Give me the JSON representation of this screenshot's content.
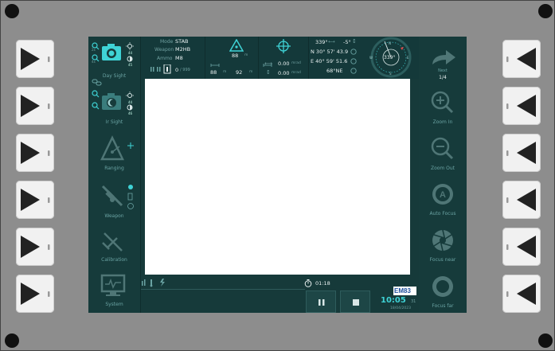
{
  "colors": {
    "bezel": "#8d8d8d",
    "screen_bg": "#163a3a",
    "accent_cyan": "#3fd3d6",
    "label_teal": "#6aa3a3",
    "icon_gray": "#4f7676",
    "alert_red": "#e04848"
  },
  "left_panel": {
    "day_sight": "Day Sight",
    "ir_sight": "Ir Sight",
    "ranging": "Ranging",
    "weapon": "Weapon",
    "calibration": "Calibration",
    "system": "System",
    "day_zoom_marks": [
      "2x",
      "4x"
    ],
    "day_brightness_marks": [
      "44",
      "45"
    ],
    "ir_brightness_marks": [
      "44",
      "46"
    ]
  },
  "header": {
    "mode_label": "Mode",
    "mode_value": "STAB",
    "weapon_label": "Weapon",
    "weapon_value": "M2HB",
    "ammo_label": "Ammo",
    "ammo_value": "M8",
    "ammo_count": "0",
    "ammo_total": "/ 999",
    "range_value": "88",
    "range_unit": "m",
    "range_left": "88",
    "range_left_unit": "m",
    "range_right": "92",
    "range_right_unit": "m",
    "mrad_h": "0.00",
    "mrad_v": "0.00",
    "mrad_unit": "mrad",
    "azimuth": "339°",
    "elevation": "-5°",
    "lat": "N 30° 57' 43.9",
    "lon": "E 40° 59' 51.6",
    "heading": "68°NE",
    "compass_value": "339°",
    "compass_marks": [
      "N",
      "E",
      "S",
      "W"
    ]
  },
  "right_panel": {
    "next_label": "Next",
    "page": "1/4",
    "zoom_in": "Zoom In",
    "zoom_out": "Zoom Out",
    "auto_focus": "Auto Focus",
    "focus_near": "Focus near",
    "focus_far": "Focus far"
  },
  "footer": {
    "timer": "01:18",
    "time": "10:05",
    "seconds": "31",
    "date": "18/04/2023",
    "logo": "EM83"
  }
}
